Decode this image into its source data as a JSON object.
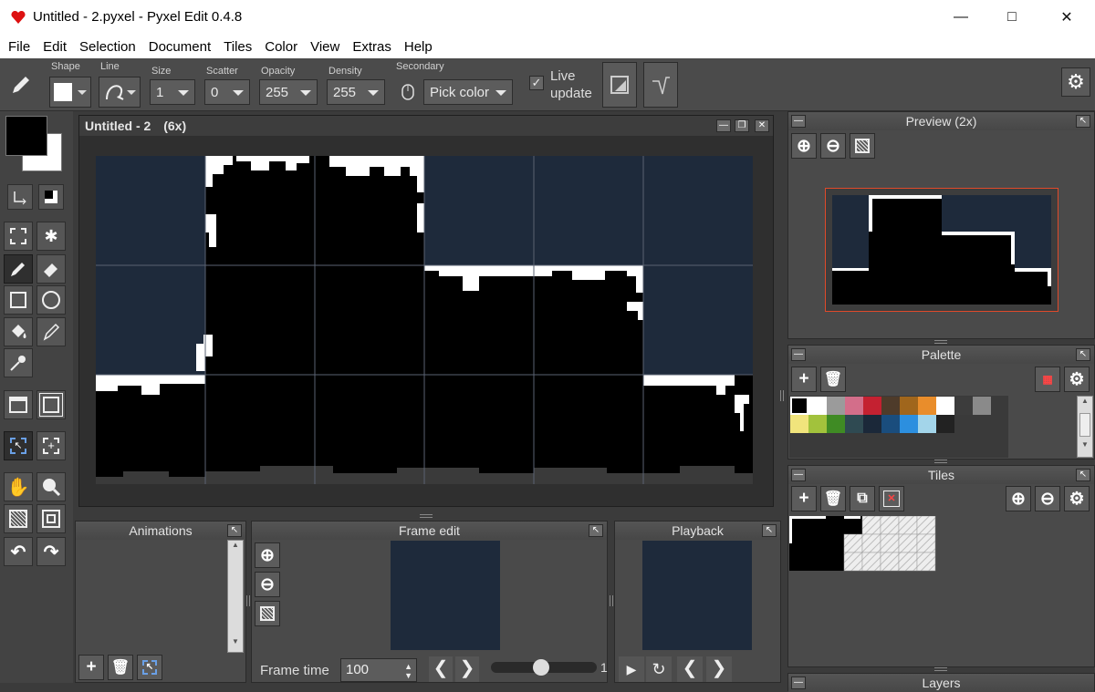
{
  "window": {
    "title": "Untitled - 2.pyxel - Pyxel Edit 0.4.8"
  },
  "menu": [
    "File",
    "Edit",
    "Selection",
    "Document",
    "Tiles",
    "Color",
    "View",
    "Extras",
    "Help"
  ],
  "toolbar": {
    "shape_label": "Shape",
    "line_label": "Line",
    "size_label": "Size",
    "size_value": "1",
    "scatter_label": "Scatter",
    "scatter_value": "0",
    "opacity_label": "Opacity",
    "opacity_value": "255",
    "density_label": "Density",
    "density_value": "255",
    "secondary_label": "Secondary",
    "secondary_value": "Pick color",
    "live_update_line1": "Live",
    "live_update_line2": "update",
    "live_update_checked": true
  },
  "canvas": {
    "title": "Untitled - 2",
    "zoom": "(6x)"
  },
  "preview": {
    "title": "Preview (2x)"
  },
  "palette": {
    "title": "Palette",
    "colors": [
      "#000000",
      "#ffffff",
      "#9b9b9b",
      "#d36e8a",
      "#c42131",
      "#4e3b2a",
      "#a0661c",
      "#e98d2b",
      "#ffffff",
      "#3c3c3c",
      "#8a8a8a",
      "#f1e47c",
      "#a2c23c",
      "#3f8b24",
      "#2f4a52",
      "#1b2839",
      "#1a4d7d",
      "#2c8fdf",
      "#a3d5ea",
      "#222222"
    ]
  },
  "tiles": {
    "title": "Tiles"
  },
  "animations": {
    "title": "Animations"
  },
  "frame_edit": {
    "title": "Frame edit",
    "frame_time_label": "Frame time",
    "frame_time_value": "100",
    "slider_value": "1"
  },
  "playback": {
    "title": "Playback"
  },
  "layers": {
    "title": "Layers"
  },
  "colors": {
    "background": "#1e2a3b",
    "foreground": "#000000",
    "snow": "#ffffff"
  }
}
